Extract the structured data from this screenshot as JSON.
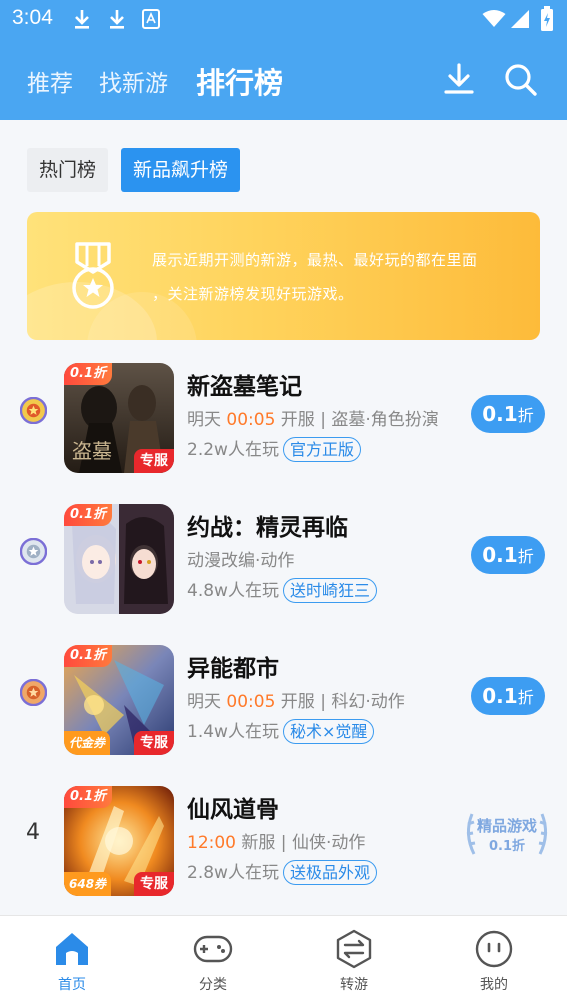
{
  "status": {
    "time": "3:04"
  },
  "header": {
    "tabs": [
      {
        "label": "推荐",
        "active": false
      },
      {
        "label": "找新游",
        "active": false
      },
      {
        "label": "排行榜",
        "active": true
      }
    ],
    "download_icon": "download-icon",
    "search_icon": "search-icon"
  },
  "chips": [
    {
      "label": "热门榜",
      "active": false
    },
    {
      "label": "新品飙升榜",
      "active": true
    }
  ],
  "banner": {
    "line1": "展示近期开测的新游，最热、最好玩的都在里面",
    "line2": "，关注新游榜发现好玩游戏。"
  },
  "games": [
    {
      "rank": "1",
      "name": "新盗墓笔记",
      "cover_discount": "0.1折",
      "cover_tag": "专服",
      "cover_tag_left": "",
      "meta_prefix": "明天 ",
      "meta_time": "00:05",
      "meta_suffix": " 开服 | 盗墓·角色扮演",
      "players": "2.2w人在玩",
      "tag": "官方正版",
      "button_num": "0.1",
      "button_unit": "折"
    },
    {
      "rank": "2",
      "name": "约战：精灵再临",
      "cover_discount": "0.1折",
      "cover_tag": "",
      "cover_tag_left": "",
      "meta_prefix": "动漫改编·动作",
      "meta_time": "",
      "meta_suffix": "",
      "players": "4.8w人在玩",
      "tag": "送时崎狂三",
      "button_num": "0.1",
      "button_unit": "折"
    },
    {
      "rank": "3",
      "name": "异能都市",
      "cover_discount": "0.1折",
      "cover_tag": "专服",
      "cover_tag_left": "代金券",
      "meta_prefix": "明天 ",
      "meta_time": "00:05",
      "meta_suffix": " 开服 | 科幻·动作",
      "players": "1.4w人在玩",
      "tag": "秘术×觉醒",
      "button_num": "0.1",
      "button_unit": "折"
    },
    {
      "rank": "4",
      "name": "仙风道骨",
      "cover_discount": "0.1折",
      "cover_tag": "专服",
      "cover_tag_left": "648券",
      "meta_prefix": "",
      "meta_time": "12:00",
      "meta_suffix": " 新服 | 仙侠·动作",
      "players": "2.8w人在玩",
      "tag": "送极品外观",
      "premium_label": "精品游戏",
      "premium_sub": "0.1折"
    }
  ],
  "bottom_nav": [
    {
      "label": "首页",
      "icon": "home-icon",
      "active": true
    },
    {
      "label": "分类",
      "icon": "gamepad-icon",
      "active": false
    },
    {
      "label": "转游",
      "icon": "transfer-icon",
      "active": false
    },
    {
      "label": "我的",
      "icon": "profile-icon",
      "active": false
    }
  ],
  "colors": {
    "primary": "#4aa6f2",
    "accent_blue": "#2b93f0",
    "orange": "#ff7a2a",
    "banner_yellow": "#ffd35c"
  }
}
